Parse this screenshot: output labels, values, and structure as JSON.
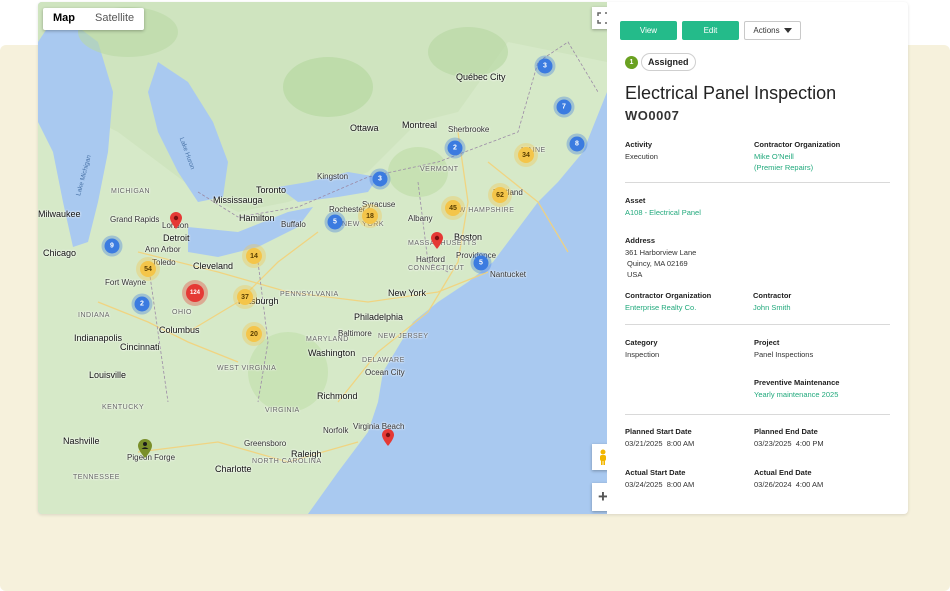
{
  "map": {
    "toggle": {
      "map_label": "Map",
      "satellite_label": "Satellite"
    },
    "places": [
      {
        "id": "quebec-city",
        "label": "Québec City"
      },
      {
        "id": "ottawa",
        "label": "Ottawa"
      },
      {
        "id": "montreal",
        "label": "Montreal"
      },
      {
        "id": "sherbrooke",
        "label": "Sherbrooke"
      },
      {
        "id": "toronto",
        "label": "Toronto"
      },
      {
        "id": "mississauga",
        "label": "Mississauga"
      },
      {
        "id": "hamilton",
        "label": "Hamilton"
      },
      {
        "id": "london",
        "label": "London"
      },
      {
        "id": "kingston",
        "label": "Kingston"
      },
      {
        "id": "buffalo",
        "label": "Buffalo"
      },
      {
        "id": "rochester",
        "label": "Rochester"
      },
      {
        "id": "syracuse",
        "label": "Syracuse"
      },
      {
        "id": "detroit",
        "label": "Detroit"
      },
      {
        "id": "cleveland",
        "label": "Cleveland"
      },
      {
        "id": "pittsburgh",
        "label": "Pittsburgh"
      },
      {
        "id": "columbus",
        "label": "Columbus"
      },
      {
        "id": "chicago",
        "label": "Chicago"
      },
      {
        "id": "milwaukee",
        "label": "Milwaukee"
      },
      {
        "id": "indianapolis",
        "label": "Indianapolis"
      },
      {
        "id": "cincinnati",
        "label": "Cincinnati"
      },
      {
        "id": "louisville",
        "label": "Louisville"
      },
      {
        "id": "nashville",
        "label": "Nashville"
      },
      {
        "id": "charlotte",
        "label": "Charlotte"
      },
      {
        "id": "greensboro",
        "label": "Greensboro"
      },
      {
        "id": "raleigh",
        "label": "Raleigh"
      },
      {
        "id": "richmond",
        "label": "Richmond"
      },
      {
        "id": "washington",
        "label": "Washington"
      },
      {
        "id": "baltimore",
        "label": "Baltimore"
      },
      {
        "id": "philadelphia",
        "label": "Philadelphia"
      },
      {
        "id": "new-york",
        "label": "New York"
      },
      {
        "id": "hartford",
        "label": "Hartford"
      },
      {
        "id": "providence",
        "label": "Providence"
      },
      {
        "id": "boston",
        "label": "Boston"
      },
      {
        "id": "portland",
        "label": "Portland"
      },
      {
        "id": "albany",
        "label": "Albany"
      },
      {
        "id": "fort-wayne",
        "label": "Fort Wayne"
      },
      {
        "id": "grand-rapids",
        "label": "Grand Rapids"
      },
      {
        "id": "ann-arbor",
        "label": "Ann Arbor"
      },
      {
        "id": "toledo",
        "label": "Toledo"
      },
      {
        "id": "norfolk",
        "label": "Norfolk"
      },
      {
        "id": "virginia-beach",
        "label": "Virginia Beach"
      },
      {
        "id": "michigan",
        "label": "MICHIGAN"
      },
      {
        "id": "ohio",
        "label": "OHIO"
      },
      {
        "id": "indiana",
        "label": "INDIANA"
      },
      {
        "id": "kentucky",
        "label": "KENTUCKY"
      },
      {
        "id": "tennessee",
        "label": "TENNESSEE"
      },
      {
        "id": "north-carolina",
        "label": "NORTH CAROLINA"
      },
      {
        "id": "virginia",
        "label": "VIRGINIA"
      },
      {
        "id": "west-virginia",
        "label": "WEST VIRGINIA"
      },
      {
        "id": "pennsylvania",
        "label": "PENNSYLVANIA"
      },
      {
        "id": "new-york-state",
        "label": "NEW YORK"
      },
      {
        "id": "maryland",
        "label": "MARYLAND"
      },
      {
        "id": "delaware",
        "label": "DELAWARE"
      },
      {
        "id": "new-jersey",
        "label": "NEW JERSEY"
      },
      {
        "id": "connecticut",
        "label": "CONNECTICUT"
      },
      {
        "id": "massachusetts",
        "label": "MASSACHUSETTS"
      },
      {
        "id": "vermont",
        "label": "VERMONT"
      },
      {
        "id": "new-hampshire",
        "label": "NEW HAMPSHIRE"
      },
      {
        "id": "maine",
        "label": "MAINE"
      },
      {
        "id": "lake-michigan",
        "label": "Lake Michigan"
      },
      {
        "id": "lake-huron",
        "label": "Lake Huron"
      },
      {
        "id": "ocean-city",
        "label": "Ocean City"
      },
      {
        "id": "nantucket",
        "label": "Nantucket"
      },
      {
        "id": "pigeon-forge",
        "label": "Pigeon Forge"
      }
    ],
    "clusters": [
      {
        "id": "c3a",
        "count": "3",
        "kind": "blue"
      },
      {
        "id": "c7",
        "count": "7",
        "kind": "blue"
      },
      {
        "id": "c8",
        "count": "8",
        "kind": "blue"
      },
      {
        "id": "c2a",
        "count": "2",
        "kind": "blue"
      },
      {
        "id": "c34",
        "count": "34",
        "kind": "yellow"
      },
      {
        "id": "c3b",
        "count": "3",
        "kind": "blue"
      },
      {
        "id": "c62",
        "count": "62",
        "kind": "yellow"
      },
      {
        "id": "c45",
        "count": "45",
        "kind": "yellow"
      },
      {
        "id": "c18",
        "count": "18",
        "kind": "yellow"
      },
      {
        "id": "c5a",
        "count": "5",
        "kind": "blue"
      },
      {
        "id": "c5b",
        "count": "5",
        "kind": "blue"
      },
      {
        "id": "c14",
        "count": "14",
        "kind": "yellow"
      },
      {
        "id": "c9",
        "count": "9",
        "kind": "blue"
      },
      {
        "id": "c54",
        "count": "54",
        "kind": "yellow"
      },
      {
        "id": "c2b",
        "count": "2",
        "kind": "blue"
      },
      {
        "id": "c37",
        "count": "37",
        "kind": "yellow"
      },
      {
        "id": "c20",
        "count": "20",
        "kind": "yellow"
      },
      {
        "id": "c124",
        "count": "124",
        "kind": "red"
      }
    ]
  },
  "toolbar": {
    "view_label": "View",
    "edit_label": "Edit",
    "actions_label": "Actions"
  },
  "status": {
    "count": "1",
    "label": "Assigned"
  },
  "work_order": {
    "title": "Electrical Panel Inspection",
    "code": "WO0007"
  },
  "fields": {
    "activity": {
      "label": "Activity",
      "value": "Execution"
    },
    "contractor_org_top": {
      "label": "Contractor Organization",
      "value_line1": "Mike O'Neill",
      "value_line2": "(Premier Repairs)"
    },
    "asset": {
      "label": "Asset",
      "value": "A108 - Electrical Panel"
    },
    "address": {
      "label": "Address",
      "line1": "361 Harborview Lane",
      "line2": "Quincy, MA 02169",
      "line3": "USA"
    },
    "contractor_org": {
      "label": "Contractor Organization",
      "value": "Enterprise Realty Co."
    },
    "contractor": {
      "label": "Contractor",
      "value": "John Smith"
    },
    "category": {
      "label": "Category",
      "value": "Inspection"
    },
    "project": {
      "label": "Project",
      "value": "Panel Inspections"
    },
    "preventive": {
      "label": "Preventive Maintenance",
      "value": "Yearly maintenance 2025"
    },
    "planned_start": {
      "label": "Planned Start Date",
      "value": "03/21/2025  8:00 AM"
    },
    "planned_end": {
      "label": "Planned End Date",
      "value": "03/23/2025  4:00 PM"
    },
    "actual_start": {
      "label": "Actual Start Date",
      "value": "03/24/2025  8:00 AM"
    },
    "actual_end": {
      "label": "Actual End Date",
      "value": "03/26/2024  4:00 AM"
    }
  },
  "colors": {
    "accent": "#24bb8a",
    "link": "#21a97c",
    "status": "#6aa121",
    "backdrop": "#f6f1dc"
  }
}
